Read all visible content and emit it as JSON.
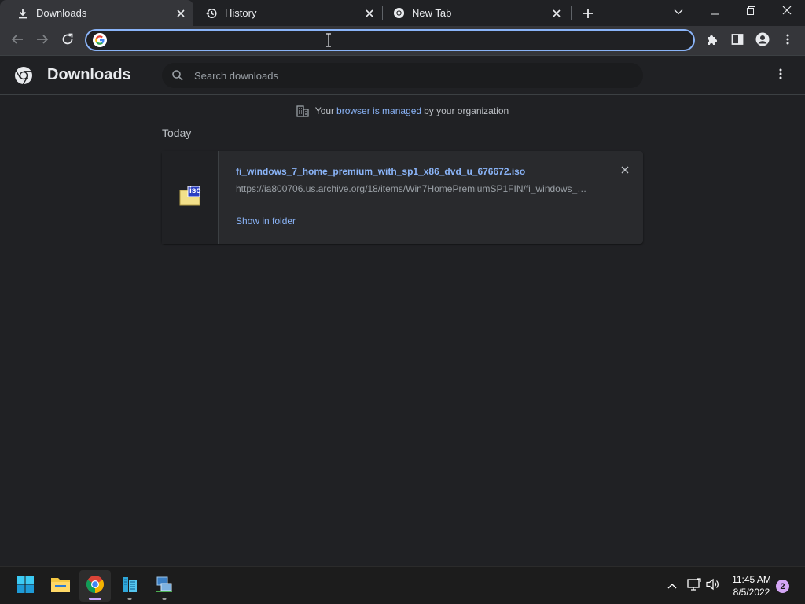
{
  "tabs": [
    {
      "title": "Downloads",
      "icon": "download-icon",
      "active": true
    },
    {
      "title": "History",
      "icon": "history-icon",
      "active": false
    },
    {
      "title": "New Tab",
      "icon": "chrome-icon",
      "active": false
    }
  ],
  "omnibox": {
    "value": "",
    "placeholder": ""
  },
  "page": {
    "title": "Downloads",
    "search_placeholder": "Search downloads",
    "managed_prefix": "Your",
    "managed_link": "browser is managed",
    "managed_suffix": "by your organization",
    "section_date": "Today"
  },
  "downloads": [
    {
      "file_name": "fi_windows_7_home_premium_with_sp1_x86_dvd_u_676672.iso",
      "url": "https://ia800706.us.archive.org/18/items/Win7HomePremiumSP1FIN/fi_windows_7...",
      "action": "Show in folder",
      "file_icon_label": "iso"
    }
  ],
  "taskbar": {
    "apps": [
      "start-icon",
      "file-explorer-icon",
      "chrome-icon",
      "server-app-icon",
      "network-app-icon"
    ],
    "time": "11:45 AM",
    "date": "8/5/2022",
    "notification_count": "2"
  },
  "colors": {
    "accent": "#8ab4f8",
    "background": "#202124",
    "toolbar": "#35363a",
    "taskbar": "#1c1c1c"
  }
}
